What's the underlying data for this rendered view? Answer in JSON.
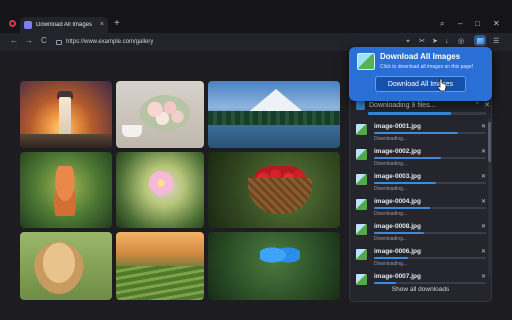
{
  "tab": {
    "title": "Download All Images",
    "close": "×"
  },
  "new_tab": "+",
  "window_controls": {
    "search": "⌕",
    "minimize": "–",
    "maximize": "□",
    "close": "✕"
  },
  "nav": {
    "back": "←",
    "forward": "→",
    "reload": "C"
  },
  "address": {
    "url": "https://www.example.com/gallery"
  },
  "toolbar_icons": [
    "⌖",
    "✂",
    "➤",
    "↓",
    "◎",
    "☰"
  ],
  "gallery": {
    "images": [
      "lighthouse-sunset",
      "rose-bouquet-teacup",
      "snowy-mountain-lake",
      "fox-in-forest",
      "pink-flower",
      "strawberry-basket",
      "golden-retriever-puppy",
      "rice-terraces",
      "blue-butterfly"
    ]
  },
  "popup": {
    "title": "Download All Images",
    "subtitle": "Click to download all images on this page!",
    "button": "Download All Images"
  },
  "downloads": {
    "header": "Downloading 9 files...",
    "header_progress": 0.7,
    "items": [
      {
        "name": "image-0001.jpg",
        "status": "Downloading...",
        "progress": 0.75
      },
      {
        "name": "image-0002.jpg",
        "status": "Downloading...",
        "progress": 0.6
      },
      {
        "name": "image-0003.jpg",
        "status": "Downloading...",
        "progress": 0.55
      },
      {
        "name": "image-0004.jpg",
        "status": "Downloading...",
        "progress": 0.5
      },
      {
        "name": "image-0008.jpg",
        "status": "Downloading...",
        "progress": 0.45
      },
      {
        "name": "image-0006.jpg",
        "status": "Downloading...",
        "progress": 0.3
      },
      {
        "name": "image-0007.jpg",
        "status": "",
        "progress": 0.2
      }
    ],
    "show_all": "Show all downloads"
  },
  "colors": {
    "accent": "#2a6fd6",
    "progress": "#3b8bdb",
    "panel_bg": "#25252d"
  }
}
